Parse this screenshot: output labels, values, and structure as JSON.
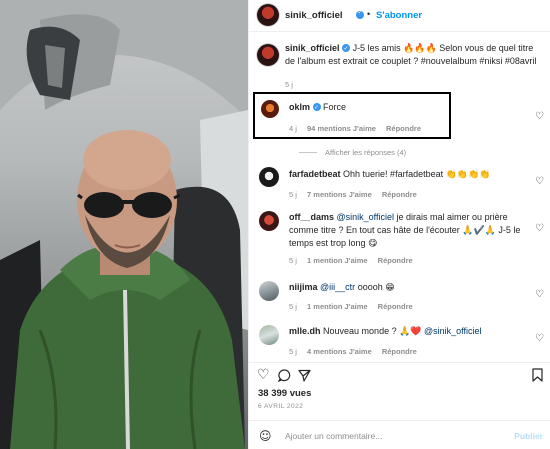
{
  "post": {
    "author": "sinik_officiel",
    "follow_label": "S'abonner",
    "separator": "•",
    "caption": {
      "username": "sinik_officiel",
      "text": "J-5 les amis 🔥🔥🔥 Selon vous de quel titre de l'album est extrait ce couplet ? #nouvelalbum #niksi #08avril",
      "age": "5 j"
    }
  },
  "comments": [
    {
      "username": "oklm",
      "verified": true,
      "text": "Force",
      "age": "4 j",
      "likes": "94 mentions J'aime",
      "reply": "Répondre",
      "highlighted": true,
      "view_replies": "Afficher les réponses (4)"
    },
    {
      "username": "farfadetbeat",
      "text": "Ohh tuerie! #farfadetbeat 👏👏👏👏",
      "age": "5 j",
      "likes": "7 mentions J'aime",
      "reply": "Répondre"
    },
    {
      "username": "off__dams",
      "mention": "@sinik_officiel",
      "text": " je dirais mal aimer ou prière comme titre ? En tout cas hâte de l'écouter 🙏✔️🙏 J-5 le temps est trop long 😋",
      "age": "5 j",
      "likes": "1 mention J'aime",
      "reply": "Répondre"
    },
    {
      "username": "niijima",
      "mention": "@iii__ctr",
      "text": " ooooh 😁",
      "age": "5 j",
      "likes": "1 mention J'aime",
      "reply": "Répondre"
    },
    {
      "username": "mlle.dh",
      "text": "Nouveau monde ? 🙏❤️ ",
      "mention": "@sinik_officiel",
      "age": "5 j",
      "likes": "4 mentions J'aime",
      "reply": "Répondre"
    }
  ],
  "actions": {
    "like_icon": "heart-outline-icon",
    "comment_icon": "speech-bubble-icon",
    "share_icon": "paper-plane-icon",
    "save_icon": "bookmark-icon"
  },
  "stats": {
    "views": "38 399 vues",
    "date": "6 AVRIL 2022"
  },
  "composer": {
    "placeholder": "Ajouter un commentaire...",
    "publish_label": "Publier"
  },
  "colors": {
    "link": "#00376b",
    "follow": "#0095f6",
    "verified": "#3897f0",
    "highlight_border": "#000000"
  }
}
